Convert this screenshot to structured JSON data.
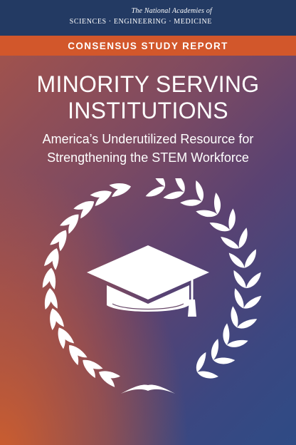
{
  "publisher": {
    "line1": "The National Academies of",
    "line2": "SCIENCES · ENGINEERING · MEDICINE"
  },
  "banner": "CONSENSUS STUDY REPORT",
  "title": {
    "line1": "MINORITY SERVING",
    "line2": "INSTITUTIONS"
  },
  "subtitle": {
    "line1": "America’s Underutilized Resource for",
    "line2": "Strengthening the STEM Workforce"
  },
  "emblem": {
    "description_icons": [
      "laurel-wreath-icon",
      "graduation-cap-icon"
    ],
    "color": "#ffffff"
  },
  "colors": {
    "header": "#233a63",
    "banner": "#d2572b",
    "gradient_warm": "#d66028",
    "gradient_cool": "#2e4b85"
  }
}
